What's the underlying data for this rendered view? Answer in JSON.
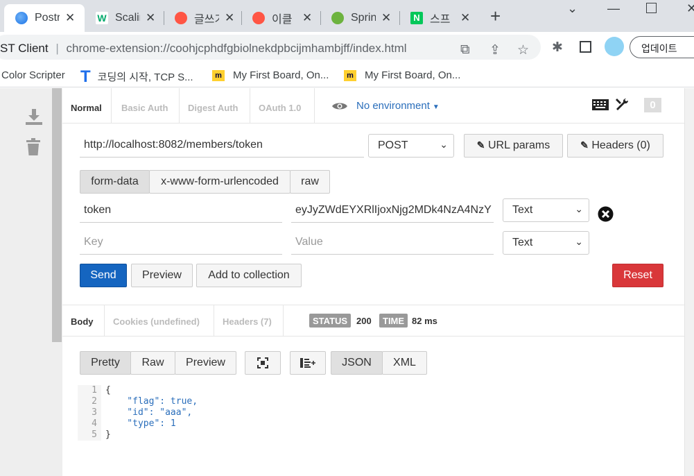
{
  "browser": {
    "tabs": [
      {
        "title": "Postr"
      },
      {
        "title": "Scalir"
      },
      {
        "title": "글쓰기"
      },
      {
        "title": "이클"
      },
      {
        "title": "Sprin"
      },
      {
        "title": "스프"
      }
    ],
    "close_glyph": "✕",
    "new_tab_glyph": "+",
    "site_name": "ST Client",
    "url": "chrome-extension://coohjcphdfgbiolnekdpbcijmhambjff/index.html",
    "update_label": "업데이트",
    "bookmarks": [
      {
        "label": "Color Scripter"
      },
      {
        "label": "코딩의 시작, TCP S..."
      },
      {
        "label": "My First Board, On..."
      },
      {
        "label": "My First Board, On..."
      }
    ]
  },
  "auth_tabs": [
    "Normal",
    "Basic Auth",
    "Digest Auth",
    "OAuth 1.0"
  ],
  "environment": "No environment",
  "request_count": "0",
  "request": {
    "url": "http://localhost:8082/members/token",
    "method": "POST",
    "url_params_label": "URL params",
    "headers_label": "Headers (0)"
  },
  "body_tabs": [
    "form-data",
    "x-www-form-urlencoded",
    "raw"
  ],
  "form_rows": [
    {
      "key": "token",
      "value": "eyJyZWdEYXRlIjoxNjg2MDk4NzA4NzY",
      "type": "Text"
    },
    {
      "key_placeholder": "Key",
      "value_placeholder": "Value",
      "type": "Text"
    }
  ],
  "actions": {
    "send": "Send",
    "preview": "Preview",
    "add_to_collection": "Add to collection",
    "reset": "Reset"
  },
  "response": {
    "tabs": [
      "Body",
      "Cookies (undefined)",
      "Headers (7)"
    ],
    "status_label": "STATUS",
    "status_value": "200",
    "time_label": "TIME",
    "time_value": "82 ms",
    "view_modes": [
      "Pretty",
      "Raw",
      "Preview"
    ],
    "formats": [
      "JSON",
      "XML"
    ],
    "line_numbers": [
      "1",
      "2",
      "3",
      "4",
      "5"
    ],
    "code_lines": [
      "{",
      "    \"flag\": true,",
      "    \"id\": \"aaa\",",
      "    \"type\": 1",
      "}"
    ]
  },
  "colors": {
    "send": "#1565c0",
    "reset": "#d9373a",
    "link": "#2a6ebb"
  }
}
